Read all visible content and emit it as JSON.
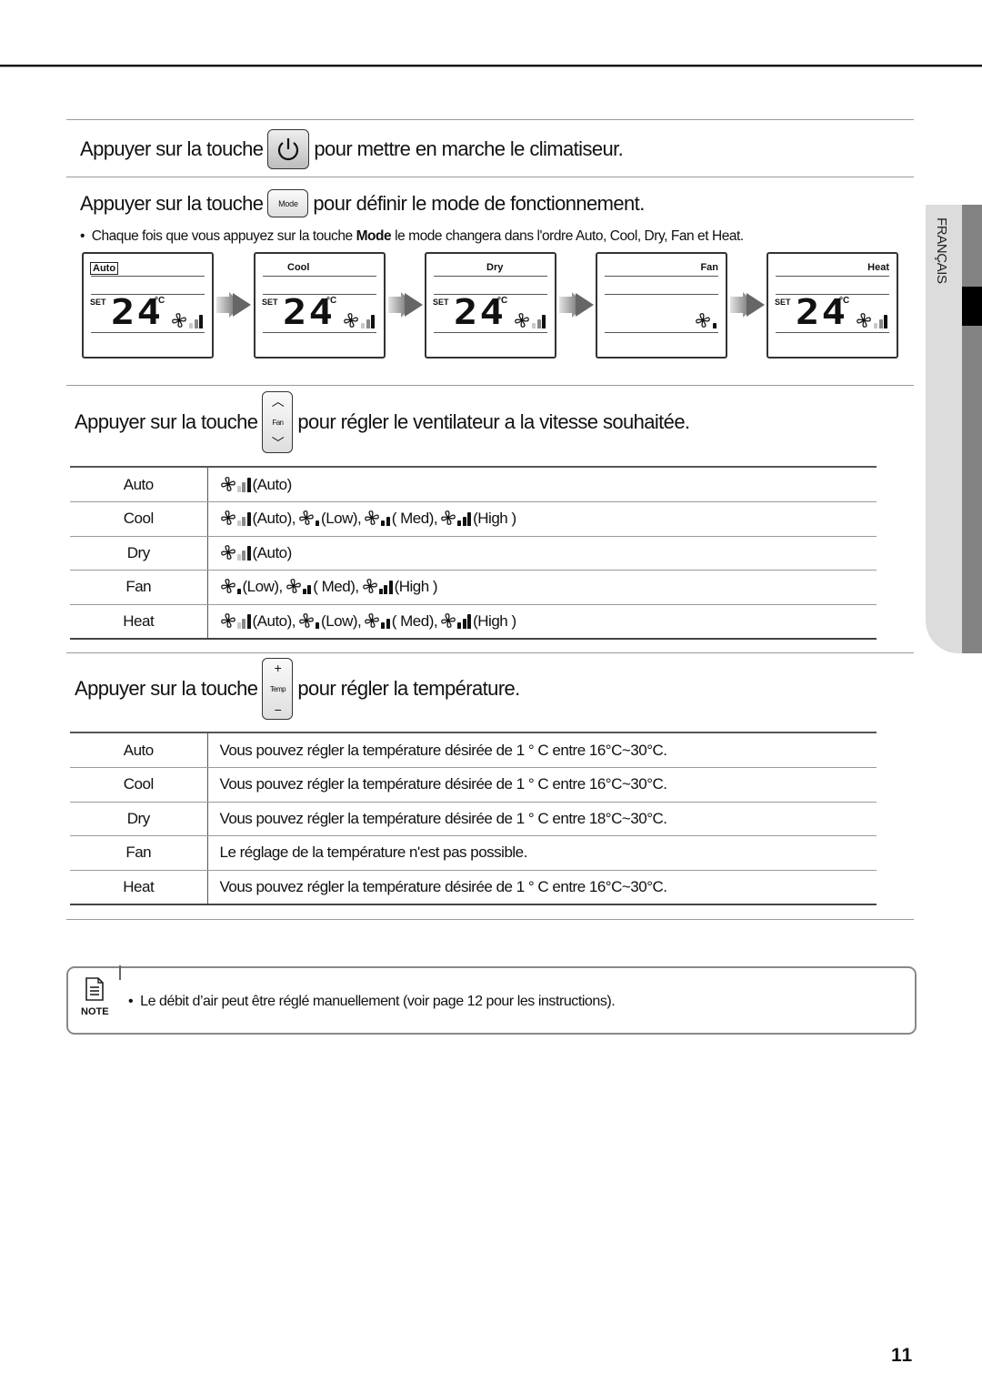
{
  "page": {
    "number": "11",
    "side_tab_label": "FRANÇAIS"
  },
  "section_power": {
    "pre": "Appuyer sur la touche",
    "key_icon": "power-icon",
    "post": "pour mettre en marche le climatiseur."
  },
  "section_mode": {
    "pre": "Appuyer sur la touche",
    "key_label": "Mode",
    "post": "pour définir le mode de fonctionnement.",
    "bullet_pre": "Chaque fois que vous appuyez sur la touche",
    "bullet_bold": "Mode",
    "bullet_post": "le mode changera dans l'ordre Auto, Cool, Dry, Fan et Heat.",
    "displays": [
      {
        "mode": "Auto",
        "set_label": "SET",
        "temperature": "24",
        "unit": "°C",
        "fan_level": "auto",
        "shows_temp": true
      },
      {
        "mode": "Cool",
        "set_label": "SET",
        "temperature": "24",
        "unit": "°C",
        "fan_level": "auto",
        "shows_temp": true
      },
      {
        "mode": "Dry",
        "set_label": "SET",
        "temperature": "24",
        "unit": "°C",
        "fan_level": "auto",
        "shows_temp": true
      },
      {
        "mode": "Fan",
        "set_label": "",
        "temperature": "",
        "unit": "",
        "fan_level": "low",
        "shows_temp": false
      },
      {
        "mode": "Heat",
        "set_label": "SET",
        "temperature": "24",
        "unit": "°C",
        "fan_level": "auto",
        "shows_temp": true
      }
    ]
  },
  "section_fan": {
    "pre": "Appuyer sur la touche",
    "key_label": "Fan",
    "post": "pour régler le ventilateur a la vitesse souhaitée.",
    "rows": [
      {
        "mode": "Auto",
        "options": [
          {
            "level": "auto",
            "label": "(Auto)"
          }
        ]
      },
      {
        "mode": "Cool",
        "options": [
          {
            "level": "auto",
            "label": "(Auto),"
          },
          {
            "level": "low",
            "label": "(Low),"
          },
          {
            "level": "med",
            "label": "( Med),"
          },
          {
            "level": "high",
            "label": "(High )"
          }
        ]
      },
      {
        "mode": "Dry",
        "options": [
          {
            "level": "auto",
            "label": "(Auto)"
          }
        ]
      },
      {
        "mode": "Fan",
        "options": [
          {
            "level": "low",
            "label": "(Low),"
          },
          {
            "level": "med",
            "label": "( Med),"
          },
          {
            "level": "high",
            "label": "(High )"
          }
        ]
      },
      {
        "mode": "Heat",
        "options": [
          {
            "level": "auto",
            "label": "(Auto),"
          },
          {
            "level": "low",
            "label": "(Low),"
          },
          {
            "level": "med",
            "label": "( Med),"
          },
          {
            "level": "high",
            "label": "(High )"
          }
        ]
      }
    ]
  },
  "section_temp": {
    "pre": "Appuyer sur la touche",
    "key_label": "Temp",
    "key_plus": "+",
    "key_minus": "−",
    "post": "pour régler la température.",
    "rows": [
      {
        "mode": "Auto",
        "desc": "Vous pouvez régler la température désirée de 1 ° C entre 16°C~30°C."
      },
      {
        "mode": "Cool",
        "desc": "Vous pouvez régler la température désirée de 1 ° C entre 16°C~30°C."
      },
      {
        "mode": "Dry",
        "desc": "Vous pouvez régler la température désirée de 1 ° C entre 18°C~30°C."
      },
      {
        "mode": "Fan",
        "desc": "Le réglage de la température n'est pas possible."
      },
      {
        "mode": "Heat",
        "desc": "Vous pouvez régler la température désirée de 1 ° C entre 16°C~30°C."
      }
    ]
  },
  "note": {
    "icon_label": "NOTE",
    "text": "Le débit d’air peut être réglé manuellement (voir page 12 pour les instructions)."
  }
}
